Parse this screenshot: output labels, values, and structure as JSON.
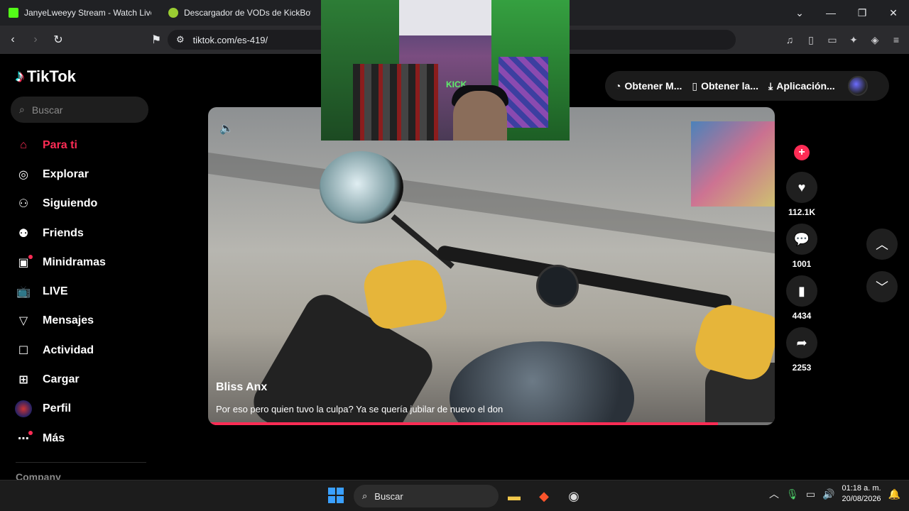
{
  "browser": {
    "tabs": [
      {
        "title": "JanyeLweeyy Stream - Watch Live on",
        "favicon_color": "#53fc18"
      },
      {
        "title": "Descargador de VODs de KickBot",
        "favicon_color": "#9acd32"
      }
    ],
    "url": "tiktok.com/es-419/"
  },
  "tiktok": {
    "logo_text": "TikTok",
    "search_placeholder": "Buscar",
    "menu": [
      {
        "label": "Para ti",
        "icon": "home-icon",
        "active": true
      },
      {
        "label": "Explorar",
        "icon": "compass-icon"
      },
      {
        "label": "Siguiendo",
        "icon": "user-follow-icon"
      },
      {
        "label": "Friends",
        "icon": "friends-icon"
      },
      {
        "label": "Minidramas",
        "icon": "film-icon",
        "badge": true
      },
      {
        "label": "LIVE",
        "icon": "live-tv-icon"
      },
      {
        "label": "Mensajes",
        "icon": "send-icon"
      },
      {
        "label": "Actividad",
        "icon": "inbox-icon"
      },
      {
        "label": "Cargar",
        "icon": "upload-plus-icon"
      },
      {
        "label": "Perfil",
        "icon": "avatar-icon"
      },
      {
        "label": "Más",
        "icon": "more-dots-icon",
        "badge": true
      }
    ],
    "company_label": "Company",
    "header": {
      "get_m": "Obtener M...",
      "get_app": "Obtener la...",
      "app": "Aplicación..."
    },
    "video": {
      "author": "Bliss Anx",
      "caption": "Por eso pero quien tuvo la culpa? Ya se quería jubilar de nuevo el don",
      "progress": 0.9
    },
    "actions": {
      "likes": "112.1K",
      "comments": "1001",
      "saves": "4434",
      "shares": "2253"
    },
    "accent_color": "#fe2c55"
  },
  "webcam": {
    "sign_text": "KICK"
  },
  "taskbar": {
    "search_label": "Buscar",
    "time": "01:18 a. m.",
    "date": "20/08/2026"
  }
}
